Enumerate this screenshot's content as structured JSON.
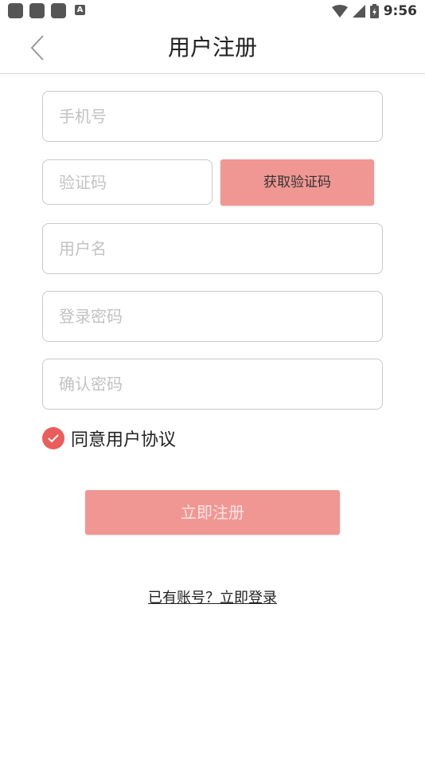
{
  "status_bar": {
    "time": "9:56",
    "notification_icons": [
      "app-icon",
      "app-icon",
      "app-icon",
      "a-icon"
    ],
    "notification_a_label": "A",
    "system_icons": [
      "wifi-icon",
      "signal-icon",
      "battery-icon"
    ]
  },
  "header": {
    "title": "用户注册",
    "back_icon": "chevron-left-icon"
  },
  "form": {
    "phone_placeholder": "手机号",
    "code_placeholder": "验证码",
    "get_code_label": "获取验证码",
    "username_placeholder": "用户名",
    "password_placeholder": "登录密码",
    "confirm_placeholder": "确认密码"
  },
  "agreement": {
    "label": "同意用户协议",
    "checked": true,
    "icon": "check-icon"
  },
  "register_label": "立即注册",
  "login_link": "已有账号？立即登录",
  "colors": {
    "accent": "#f19793",
    "check": "#ea5d5b",
    "border": "#c9c9c9",
    "placeholder": "#c2c2c2"
  }
}
